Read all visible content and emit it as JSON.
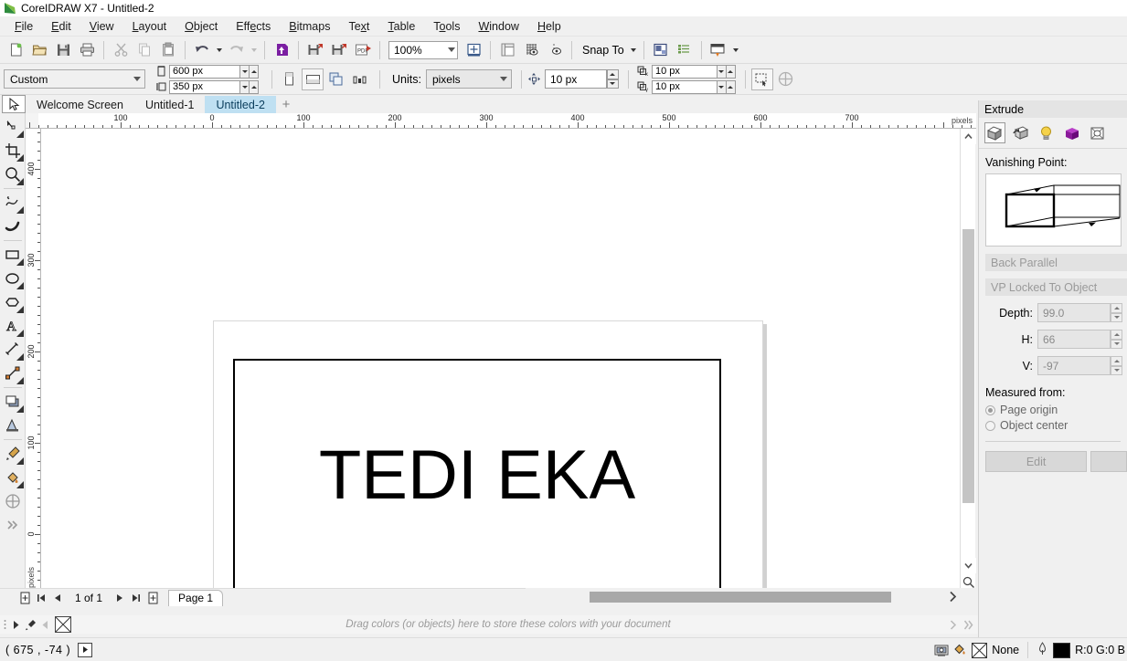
{
  "window": {
    "app_title": "CoreIDRAW X7 - Untitled-2",
    "logo_icon": "coreldraw-logo-icon"
  },
  "menubar": {
    "items": [
      {
        "label": "File"
      },
      {
        "label": "Edit"
      },
      {
        "label": "View"
      },
      {
        "label": "Layout"
      },
      {
        "label": "Object"
      },
      {
        "label": "Effects"
      },
      {
        "label": "Bitmaps"
      },
      {
        "label": "Text"
      },
      {
        "label": "Table"
      },
      {
        "label": "Tools"
      },
      {
        "label": "Window"
      },
      {
        "label": "Help"
      }
    ]
  },
  "toolbar": {
    "zoom_level": "100%",
    "snap_to_label": "Snap To",
    "buttons": [
      {
        "name": "new-document-button",
        "icon": "new-page-icon"
      },
      {
        "name": "open-button",
        "icon": "folder-open-icon"
      },
      {
        "name": "save-button",
        "icon": "floppy-disk-icon"
      },
      {
        "name": "print-button",
        "icon": "printer-icon"
      },
      {
        "name": "cut-button",
        "icon": "scissors-icon"
      },
      {
        "name": "copy-button",
        "icon": "copy-icon"
      },
      {
        "name": "paste-button",
        "icon": "clipboard-icon"
      },
      {
        "name": "undo-button",
        "icon": "undo-arrow-icon"
      },
      {
        "name": "redo-button",
        "icon": "redo-arrow-icon"
      },
      {
        "name": "import-button",
        "icon": "import-icon"
      },
      {
        "name": "export-button",
        "icon": "export-icon"
      },
      {
        "name": "publish-pdf-button",
        "icon": "pdf-icon"
      },
      {
        "name": "zoom-levels-combo",
        "icon": "chevron-down-icon"
      },
      {
        "name": "full-screen-preview-button",
        "icon": "fullscreen-icon"
      },
      {
        "name": "show-rulers-button",
        "icon": "ruler-icon"
      },
      {
        "name": "show-grid-button",
        "icon": "grid-eye-icon"
      },
      {
        "name": "show-guides-button",
        "icon": "guides-eye-icon"
      },
      {
        "name": "options-button",
        "icon": "options-icon"
      },
      {
        "name": "object-manager-button",
        "icon": "object-manager-icon"
      },
      {
        "name": "application-launcher-button",
        "icon": "launcher-icon"
      }
    ]
  },
  "propbar": {
    "page_preset": "Custom",
    "page_width": "600 px",
    "page_height": "350 px",
    "units_label": "Units:",
    "units_value": "pixels",
    "nudge_value": "10 px",
    "duplicate_x": "10 px",
    "duplicate_y": "10 px",
    "orientation_portrait": "portrait-icon",
    "orientation_landscape": "landscape-icon"
  },
  "tabbar": {
    "tabs": [
      {
        "label": "Welcome Screen",
        "active": false
      },
      {
        "label": "Untitled-1",
        "active": false
      },
      {
        "label": "Untitled-2",
        "active": true
      }
    ],
    "add_tab": "+"
  },
  "toolbox": {
    "tools": [
      {
        "name": "pick-tool",
        "icon": "arrow-cursor-icon"
      },
      {
        "name": "shape-tool",
        "icon": "node-edit-icon"
      },
      {
        "name": "crop-tool",
        "icon": "crop-icon"
      },
      {
        "name": "zoom-tool",
        "icon": "magnifier-icon"
      },
      {
        "name": "freehand-tool",
        "icon": "freehand-curve-icon"
      },
      {
        "name": "artistic-media-tool",
        "icon": "brush-stroke-icon"
      },
      {
        "name": "rectangle-tool",
        "icon": "rectangle-icon"
      },
      {
        "name": "ellipse-tool",
        "icon": "ellipse-icon"
      },
      {
        "name": "polygon-tool",
        "icon": "polygon-icon"
      },
      {
        "name": "text-tool",
        "icon": "letter-a-icon"
      },
      {
        "name": "parallel-dimension-tool",
        "icon": "dimension-icon"
      },
      {
        "name": "straight-line-connector-tool",
        "icon": "connector-icon"
      },
      {
        "name": "drop-shadow-tool",
        "icon": "drop-shadow-icon"
      },
      {
        "name": "transparency-tool",
        "icon": "transparency-icon"
      },
      {
        "name": "color-eyedropper-tool",
        "icon": "eyedropper-icon"
      },
      {
        "name": "interactive-fill-tool",
        "icon": "fill-bucket-icon"
      },
      {
        "name": "smart-fill-tool",
        "icon": "smart-fill-icon"
      },
      {
        "name": "expand-toolbox",
        "icon": "double-chevron-icon"
      }
    ]
  },
  "rulers": {
    "unit_label": "pixels",
    "horizontal_ticks": [
      "100",
      "0",
      "100",
      "200",
      "300",
      "400",
      "500",
      "600",
      "700"
    ],
    "vertical_ticks": [
      "400",
      "300",
      "200",
      "100",
      "0"
    ]
  },
  "canvas": {
    "object_text": "TEDI EKA"
  },
  "navigator": {
    "page_count_label": "1 of 1",
    "page_tab_label": "Page 1",
    "first_page_icon": "first-page-icon",
    "prev_page_icon": "prev-page-icon",
    "next_page_icon": "next-page-icon",
    "last_page_icon": "last-page-icon"
  },
  "palette": {
    "hint": "Drag colors (or objects) here to store these colors with your document",
    "no_color_icon": "no-color-x-icon"
  },
  "docker": {
    "title": "Extrude",
    "tabs": [
      {
        "name": "extrude-tab",
        "icon": "extrude-cube-icon",
        "selected": true
      },
      {
        "name": "rotation-tab",
        "icon": "rotate-cube-icon",
        "selected": false
      },
      {
        "name": "lighting-tab",
        "icon": "light-bulb-icon",
        "selected": false
      },
      {
        "name": "color-tab",
        "icon": "color-cube-icon",
        "selected": false
      },
      {
        "name": "bevel-tab",
        "icon": "bevel-cube-icon",
        "selected": false
      }
    ],
    "vanishing_point_label": "Vanishing Point:",
    "extrude_type": "Back Parallel",
    "vp_lock": "VP Locked To Object",
    "depth_label": "Depth:",
    "depth_value": "99.0",
    "h_label": "H:",
    "h_value": "66",
    "v_label": "V:",
    "v_value": "-97",
    "measured_from_label": "Measured from:",
    "radio_page_origin": "Page origin",
    "radio_object_center": "Object center",
    "edit_button": "Edit"
  },
  "statusbar": {
    "coordinates": "( 675  , -74  )",
    "fill_value": "None",
    "outline_value": "R:0 G:0 B",
    "snapshot_icon": "snapshot-icon",
    "fill-icon": "fill-bucket-icon",
    "outline-icon": "pen-nib-icon"
  },
  "colors": {
    "accent_tab": "#bfe0f2",
    "chrome": "#f0f0f0",
    "canvas": "#ffffff",
    "purple": "#7b1fa2",
    "outline_black": "#000000"
  }
}
